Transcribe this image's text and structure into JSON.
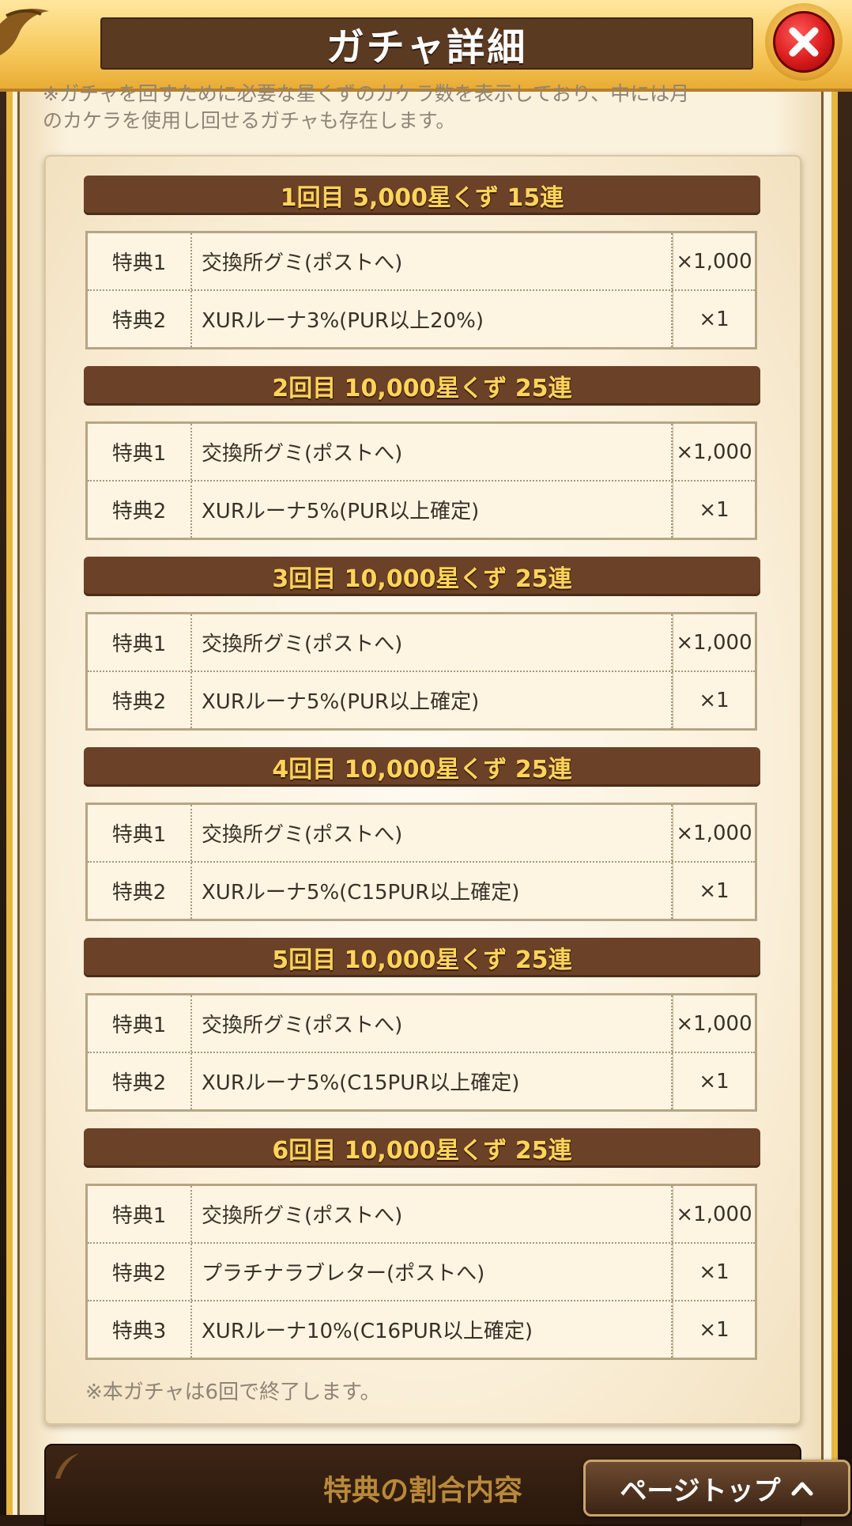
{
  "header": {
    "title": "ガチャ詳細"
  },
  "note": {
    "line1": "※ガチャを回すために必要な星くずのカケラ数を表示しており、中には月",
    "line2": "のカケラを使用し回せるガチャも存在します。"
  },
  "sections": [
    {
      "title": "1回目 5,000星くず 15連",
      "rows": [
        {
          "label": "特典1",
          "item": "交換所グミ(ポストへ)",
          "qty": "×1,000"
        },
        {
          "label": "特典2",
          "item": "XURルーナ3%(PUR以上20%)",
          "qty": "×1"
        }
      ]
    },
    {
      "title": "2回目 10,000星くず 25連",
      "rows": [
        {
          "label": "特典1",
          "item": "交換所グミ(ポストへ)",
          "qty": "×1,000"
        },
        {
          "label": "特典2",
          "item": "XURルーナ5%(PUR以上確定)",
          "qty": "×1"
        }
      ]
    },
    {
      "title": "3回目 10,000星くず 25連",
      "rows": [
        {
          "label": "特典1",
          "item": "交換所グミ(ポストへ)",
          "qty": "×1,000"
        },
        {
          "label": "特典2",
          "item": "XURルーナ5%(PUR以上確定)",
          "qty": "×1"
        }
      ]
    },
    {
      "title": "4回目 10,000星くず 25連",
      "rows": [
        {
          "label": "特典1",
          "item": "交換所グミ(ポストへ)",
          "qty": "×1,000"
        },
        {
          "label": "特典2",
          "item": "XURルーナ5%(C15PUR以上確定)",
          "qty": "×1"
        }
      ]
    },
    {
      "title": "5回目 10,000星くず 25連",
      "rows": [
        {
          "label": "特典1",
          "item": "交換所グミ(ポストへ)",
          "qty": "×1,000"
        },
        {
          "label": "特典2",
          "item": "XURルーナ5%(C15PUR以上確定)",
          "qty": "×1"
        }
      ]
    },
    {
      "title": "6回目 10,000星くず 25連",
      "rows": [
        {
          "label": "特典1",
          "item": "交換所グミ(ポストへ)",
          "qty": "×1,000"
        },
        {
          "label": "特典2",
          "item": "プラチナラブレター(ポストへ)",
          "qty": "×1"
        },
        {
          "label": "特典3",
          "item": "XURルーナ10%(C16PUR以上確定)",
          "qty": "×1"
        }
      ]
    }
  ],
  "end_note": "※本ガチャは6回で終了します。",
  "bottom": {
    "section_title": "特典の割合内容",
    "page_top_label": "ページトップ"
  },
  "icons": {
    "close": "close-icon",
    "page_top": "chevron-up-icon"
  }
}
